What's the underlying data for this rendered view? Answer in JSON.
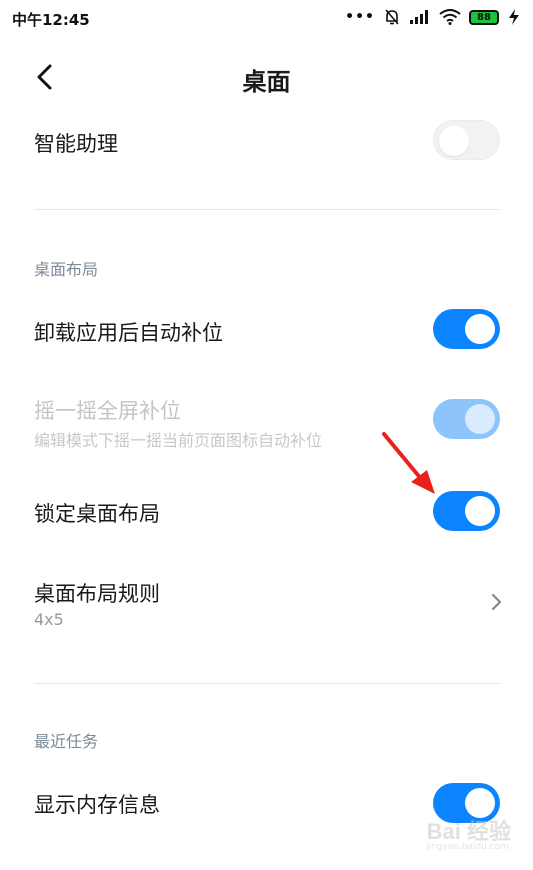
{
  "status_bar": {
    "time": "中午12:45",
    "dots": "•••",
    "battery": "88",
    "icons": [
      "mute-bell-icon",
      "signal-icon",
      "wifi-icon",
      "battery-icon",
      "charging-bolt-icon"
    ]
  },
  "header": {
    "title": "桌面",
    "back_icon": "chevron-left-icon"
  },
  "rows": {
    "assistant": {
      "title": "智能助理",
      "toggle": "off"
    },
    "auto_fill": {
      "title": "卸载应用后自动补位",
      "toggle": "on"
    },
    "shake_fill": {
      "title": "摇一摇全屏补位",
      "subtitle": "编辑模式下摇一摇当前页面图标自动补位",
      "toggle": "on",
      "enabled": false
    },
    "lock_layout": {
      "title": "锁定桌面布局",
      "toggle": "on"
    },
    "layout_rule": {
      "title": "桌面布局规则",
      "value": "4x5",
      "icon": "chevron-right-icon"
    },
    "memory_info": {
      "title": "显示内存信息",
      "toggle": "on"
    }
  },
  "sections": {
    "layout": "桌面布局",
    "recent": "最近任务"
  },
  "colors": {
    "toggle_on": "#0d84ff",
    "toggle_disabled": "#8cc4fb",
    "annotation_arrow": "#e8211d",
    "section_header": "#7d8a99"
  },
  "watermark": {
    "main": "Bai 经验",
    "sub": "jingyan.baidu.com"
  }
}
